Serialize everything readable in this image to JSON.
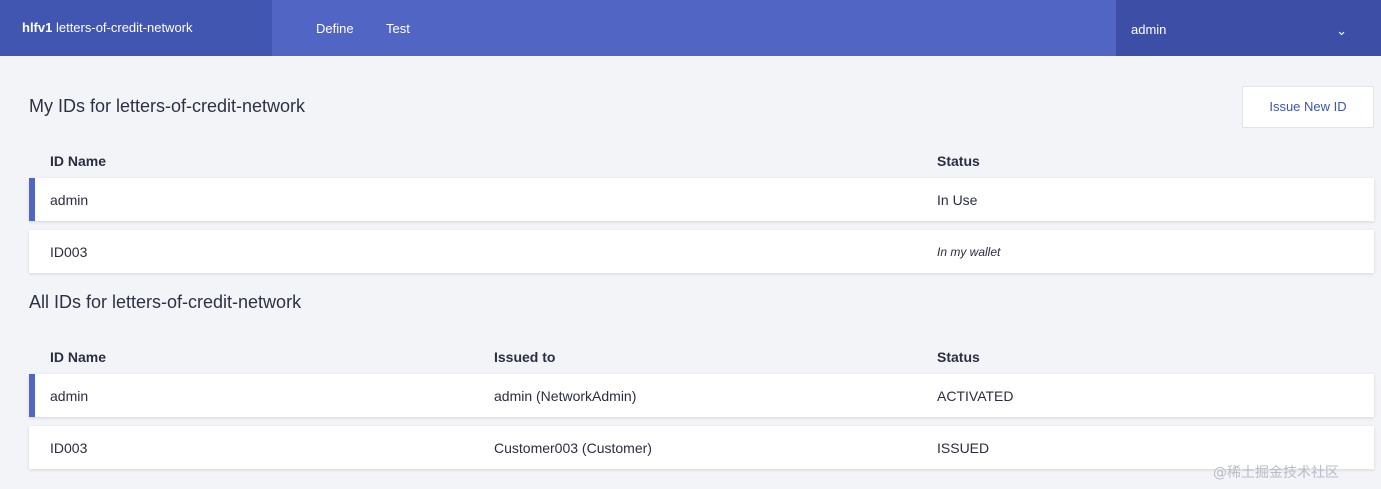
{
  "header": {
    "brand_bold": "hlfv1",
    "brand_name": "letters-of-credit-network",
    "tabs": [
      {
        "label": "Define"
      },
      {
        "label": "Test"
      }
    ],
    "user": "admin",
    "user_chevron": "⌄"
  },
  "my_ids": {
    "title": "My IDs for letters-of-credit-network",
    "issue_button": "Issue New ID",
    "columns": [
      "ID Name",
      "Status"
    ],
    "rows": [
      {
        "name": "admin",
        "status": "In Use",
        "active": true
      },
      {
        "name": "ID003",
        "status": "In my wallet",
        "active": false
      }
    ]
  },
  "all_ids": {
    "title": "All IDs for letters-of-credit-network",
    "columns": [
      "ID Name",
      "Issued to",
      "Status"
    ],
    "rows": [
      {
        "name": "admin",
        "issued_to": "admin (NetworkAdmin)",
        "status": "ACTIVATED",
        "active": true
      },
      {
        "name": "ID003",
        "issued_to": "Customer003 (Customer)",
        "status": "ISSUED",
        "active": false
      }
    ]
  },
  "watermark": "@稀土掘金技术社区",
  "colors": {
    "header": "#5166c4",
    "brand_bg": "#4156b0",
    "user_bg": "#3d4ea6",
    "accent": "#5166c4"
  }
}
